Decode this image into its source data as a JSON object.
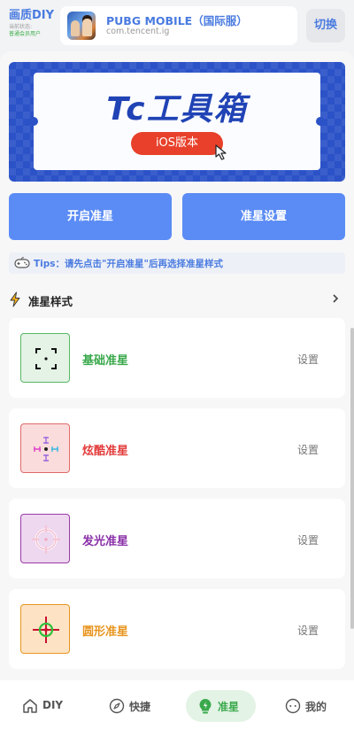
{
  "header": {
    "brand_title": "画质DIY",
    "brand_status_label": "当前状态:",
    "brand_status_value": "普通会员用户",
    "game_name": "PUBG MOBILE（国际服）",
    "game_package": "com.tencent.ig",
    "switch_label": "切换"
  },
  "banner": {
    "title": "Tc工具箱",
    "pill": "iOS版本",
    "bg_color": "#2b52c7",
    "title_color": "#2043b5",
    "pill_color": "#e8402a"
  },
  "actions": {
    "enable_label": "开启准星",
    "settings_label": "准星设置",
    "color": "#5b8cf5"
  },
  "tips": {
    "text": "Tips：请先点击\"开启准星\"后再选择准星样式",
    "icon": "controller-icon"
  },
  "section": {
    "title": "准星样式",
    "icon": "lightning-icon",
    "more_icon": "chevron-right-icon"
  },
  "crosshairs": [
    {
      "label": "基础准星",
      "action": "设置",
      "color": "#3aa94c",
      "icon": "basic-crosshair-icon"
    },
    {
      "label": "炫酷准星",
      "action": "设置",
      "color": "#e23b3b",
      "icon": "cool-crosshair-icon"
    },
    {
      "label": "发光准星",
      "action": "设置",
      "color": "#8a2fa8",
      "icon": "glow-crosshair-icon"
    },
    {
      "label": "圆形准星",
      "action": "设置",
      "color": "#e8951f",
      "icon": "circle-crosshair-icon"
    }
  ],
  "bottom_nav": {
    "items": [
      {
        "label": "DIY",
        "icon": "home-icon",
        "active": false
      },
      {
        "label": "快捷",
        "icon": "compass-icon",
        "active": false
      },
      {
        "label": "准星",
        "icon": "bulb-icon",
        "active": true
      },
      {
        "label": "我的",
        "icon": "face-icon",
        "active": false
      }
    ],
    "active_color": "#3aa94c"
  }
}
